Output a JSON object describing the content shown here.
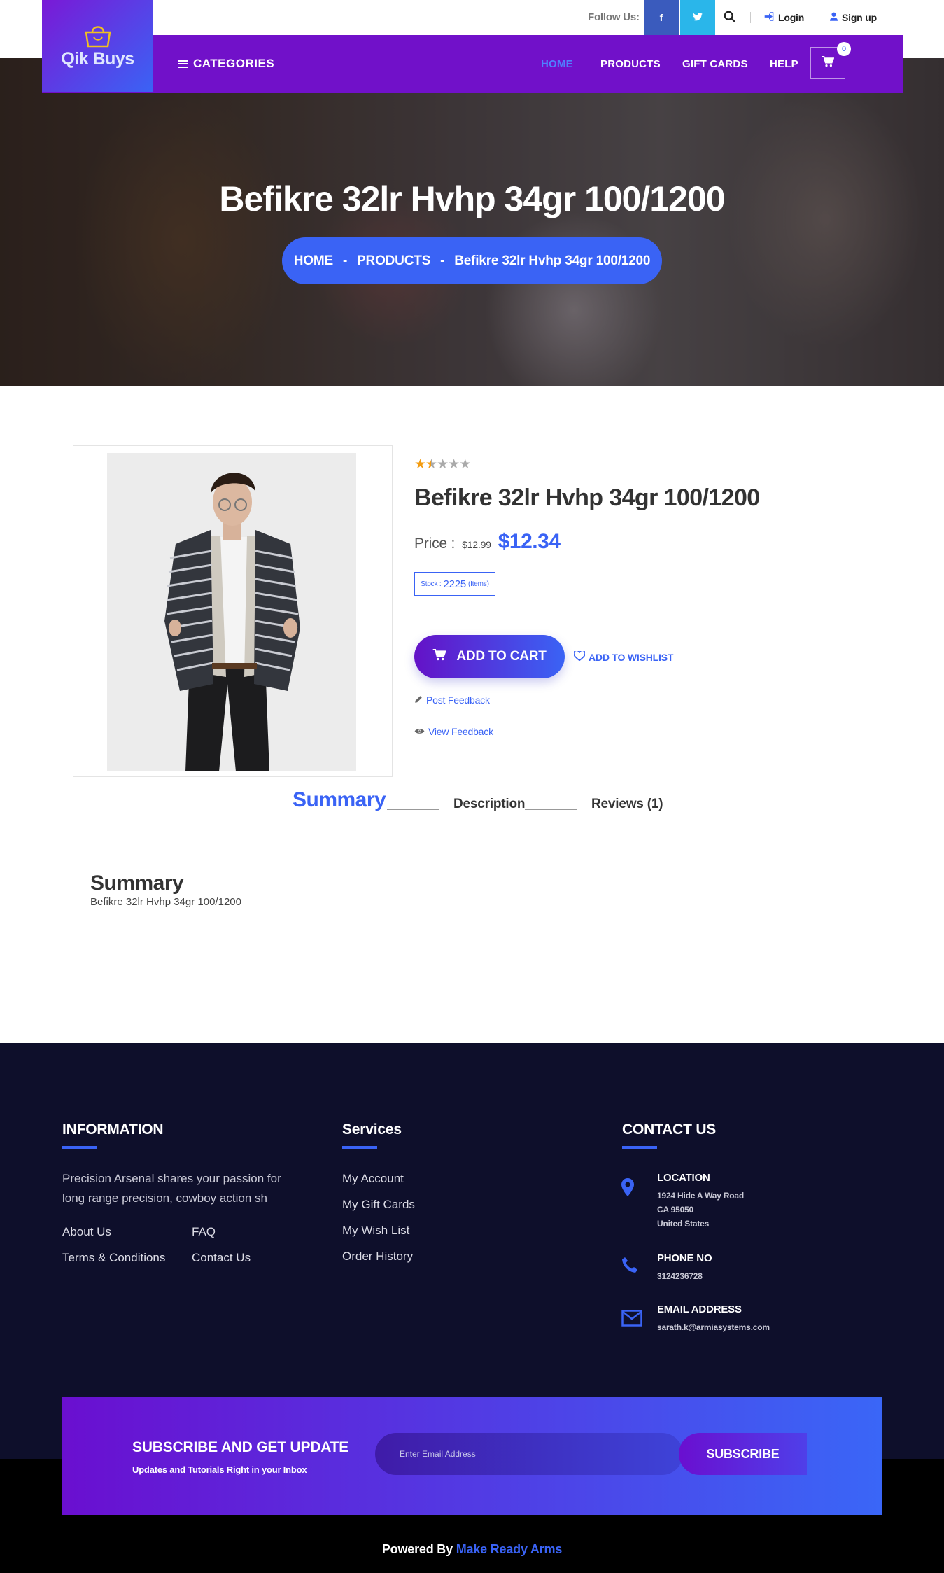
{
  "brand": {
    "logo_text": "Qik Buys"
  },
  "topbar": {
    "follow_label": "Follow Us:",
    "facebook": "f",
    "twitter": "t",
    "login": "Login",
    "signup": "Sign up"
  },
  "nav": {
    "categories": "CATEGORIES",
    "links": [
      "HOME",
      "PRODUCTS",
      "GIFT CARDS",
      "HELP"
    ],
    "cart_count": "0"
  },
  "hero": {
    "title": "Befikre 32lr Hvhp 34gr 100/1200",
    "breadcrumb": [
      "HOME",
      "-",
      "PRODUCTS",
      "-",
      "Befikre 32lr Hvhp 34gr 100/1200"
    ]
  },
  "product": {
    "rating": 1.5,
    "rating_max": 5,
    "title": "Befikre 32lr Hvhp 34gr 100/1200",
    "price_label": "Price :",
    "old_price": "$12.99",
    "new_price": "$12.34",
    "stock_label": "Stock :",
    "stock_value": "2225",
    "stock_unit": "(Items)",
    "add_to_cart": "ADD TO CART",
    "add_to_wishlist": "ADD TO WISHLIST",
    "post_feedback": "Post Feedback",
    "view_feedback": "View Feedback"
  },
  "tabs": {
    "items": [
      "Summary",
      "Description",
      "Reviews (1)"
    ],
    "active": "Summary"
  },
  "summary": {
    "heading": "Summary",
    "text": "Befikre 32lr Hvhp 34gr 100/1200"
  },
  "footer": {
    "information": {
      "heading": "INFORMATION",
      "text": "Precision Arsenal shares your passion for long range precision, cowboy action sh",
      "links": [
        "About Us",
        "FAQ",
        "Terms & Conditions",
        "Contact Us"
      ]
    },
    "services": {
      "heading": "Services",
      "links": [
        "My Account",
        "My Gift Cards",
        "My Wish List",
        "Order History"
      ]
    },
    "contact": {
      "heading": "CONTACT US",
      "location_label": "LOCATION",
      "location_lines": [
        "1924 Hide A Way Road",
        "CA 95050",
        "United States"
      ],
      "phone_label": "PHONE NO",
      "phone": "3124236728",
      "email_label": "EMAIL ADDRESS",
      "email": "sarath.k@armiasystems.com"
    },
    "subscribe": {
      "title": "SUBSCRIBE AND GET UPDATE",
      "subtitle": "Updates and Tutorials Right in your Inbox",
      "placeholder": "Enter Email Address",
      "button": "SUBSCRIBE"
    },
    "powered_prefix": "Powered By",
    "powered_brand": "Make Ready Arms"
  },
  "colors": {
    "accent": "#3a63f5",
    "nav_purple": "#7111c9",
    "footer_bg": "#0e0f2b",
    "star": "#f39c12"
  }
}
